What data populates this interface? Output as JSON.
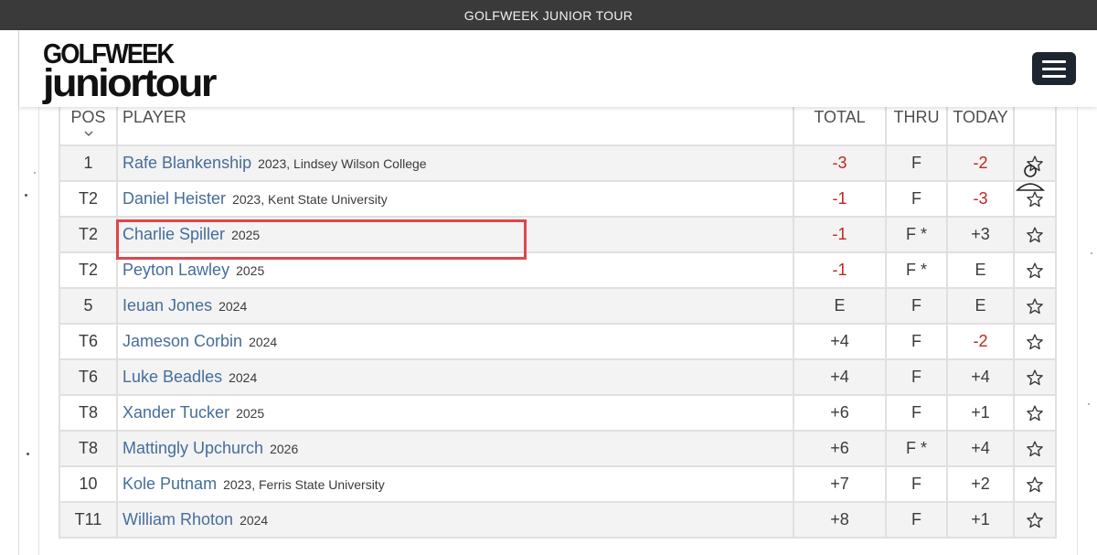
{
  "topbar": {
    "title": "GOLFWEEK JUNIOR TOUR"
  },
  "logo": {
    "line1": "GOLFWEEK",
    "line2": "juniortour"
  },
  "table": {
    "headers": {
      "pos": "POS",
      "player": "PLAYER",
      "total": "TOTAL",
      "thru": "THRU",
      "today": "TODAY"
    },
    "rows": [
      {
        "pos": "1",
        "name": "Rafe Blankenship",
        "info": "2023, Lindsey Wilson College",
        "total": "-3",
        "thru": "F",
        "today": "-2"
      },
      {
        "pos": "T2",
        "name": "Daniel Heister",
        "info": "2023, Kent State University",
        "total": "-1",
        "thru": "F",
        "today": "-3"
      },
      {
        "pos": "T2",
        "name": "Charlie Spiller",
        "info": "2025",
        "total": "-1",
        "thru": "F *",
        "today": "+3"
      },
      {
        "pos": "T2",
        "name": "Peyton Lawley",
        "info": "2025",
        "total": "-1",
        "thru": "F *",
        "today": "E"
      },
      {
        "pos": "5",
        "name": "Ieuan Jones",
        "info": "2024",
        "total": "E",
        "thru": "F",
        "today": "E"
      },
      {
        "pos": "T6",
        "name": "Jameson Corbin",
        "info": "2024",
        "total": "+4",
        "thru": "F",
        "today": "-2"
      },
      {
        "pos": "T6",
        "name": "Luke Beadles",
        "info": "2024",
        "total": "+4",
        "thru": "F",
        "today": "+4"
      },
      {
        "pos": "T8",
        "name": "Xander Tucker",
        "info": "2025",
        "total": "+6",
        "thru": "F",
        "today": "+1"
      },
      {
        "pos": "T8",
        "name": "Mattingly Upchurch",
        "info": "2026",
        "total": "+6",
        "thru": "F *",
        "today": "+4"
      },
      {
        "pos": "10",
        "name": "Kole Putnam",
        "info": "2023, Ferris State University",
        "total": "+7",
        "thru": "F",
        "today": "+2"
      },
      {
        "pos": "T11",
        "name": "William Rhoton",
        "info": "2024",
        "total": "+8",
        "thru": "F",
        "today": "+1"
      }
    ]
  },
  "icons": {
    "sort": "chevron-down-icon",
    "favorite": "star-outline-icon",
    "menu": "hamburger-menu-icon",
    "overlay": "person-icon"
  },
  "colors": {
    "negative": "#c0261f",
    "link": "#446d9c",
    "highlight": "#e0454a",
    "topbar": "#3a3a3a",
    "menu_button": "#1c2530"
  }
}
